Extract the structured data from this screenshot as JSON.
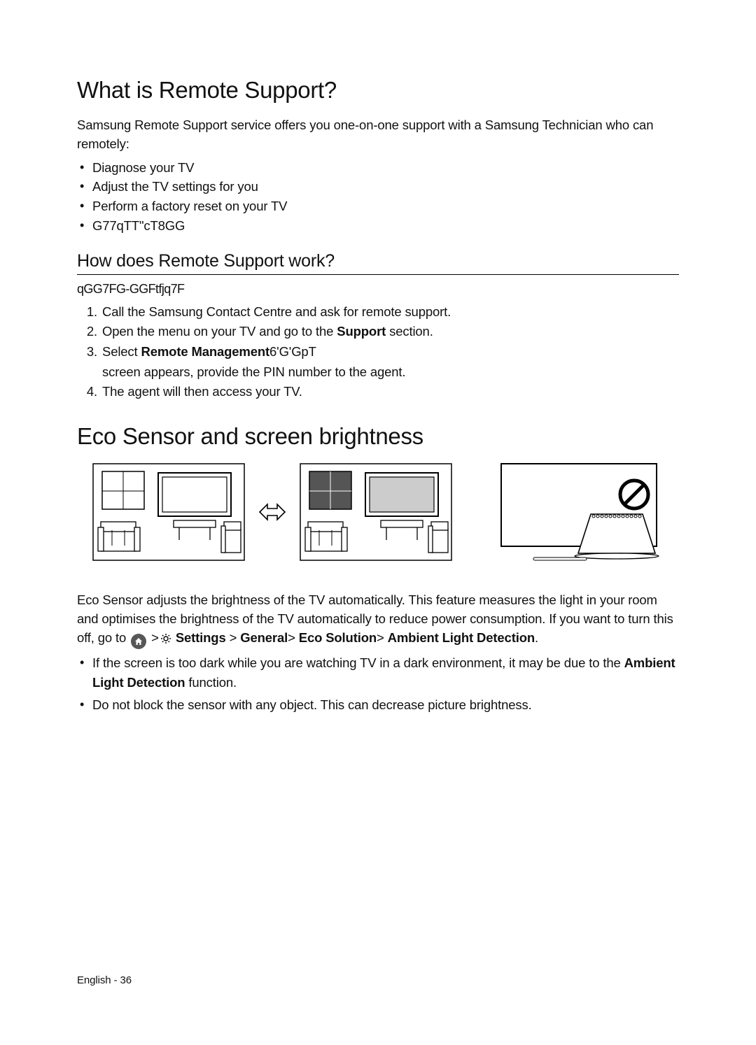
{
  "section1": {
    "title": "What is Remote Support?",
    "intro": "Samsung Remote Support service offers you one-on-one support with a Samsung Technician who can remotely:",
    "bullets": [
      "Diagnose your TV",
      "Adjust the TV settings for you",
      "Perform a factory reset on your TV",
      "    G77qTT\"cT8GG"
    ]
  },
  "section2": {
    "title": "How does Remote Support work?",
    "lead_corrupt": "qGG7FG-GGFtfjq7F",
    "steps": [
      {
        "pre": "Call the Samsung Contact Centre and ask for remote support."
      },
      {
        "pre": "Open the menu on your TV and go to the",
        "bold": "Support",
        "post": " section."
      },
      {
        "pre": "Select ",
        "bold": "Remote Management",
        "garble": "6'G'GpT",
        "post2": "screen appears, provide the PIN number to the agent."
      },
      {
        "pre": "The agent will then access your TV."
      }
    ]
  },
  "section3": {
    "title": "Eco Sensor and screen brightness",
    "para_pre": "Eco Sensor adjusts the brightness of the TV automatically. This feature measures the light in your room and optimises the brightness of the TV automatically to reduce power consumption. If you want to turn this off, go to ",
    "path": {
      "settings": "Settings",
      "general": "General",
      "eco": "Eco Solution",
      "ambient": "Ambient Light Detection"
    },
    "bullets": [
      {
        "pre": "If the screen is too dark while you are watching TV in a dark environment, it may be due to the ",
        "bold": "Ambient Light Detection",
        "post": "  function."
      },
      {
        "pre": "Do not block the sensor with any object. This can decrease picture brightness."
      }
    ]
  },
  "footer": "English - 36"
}
